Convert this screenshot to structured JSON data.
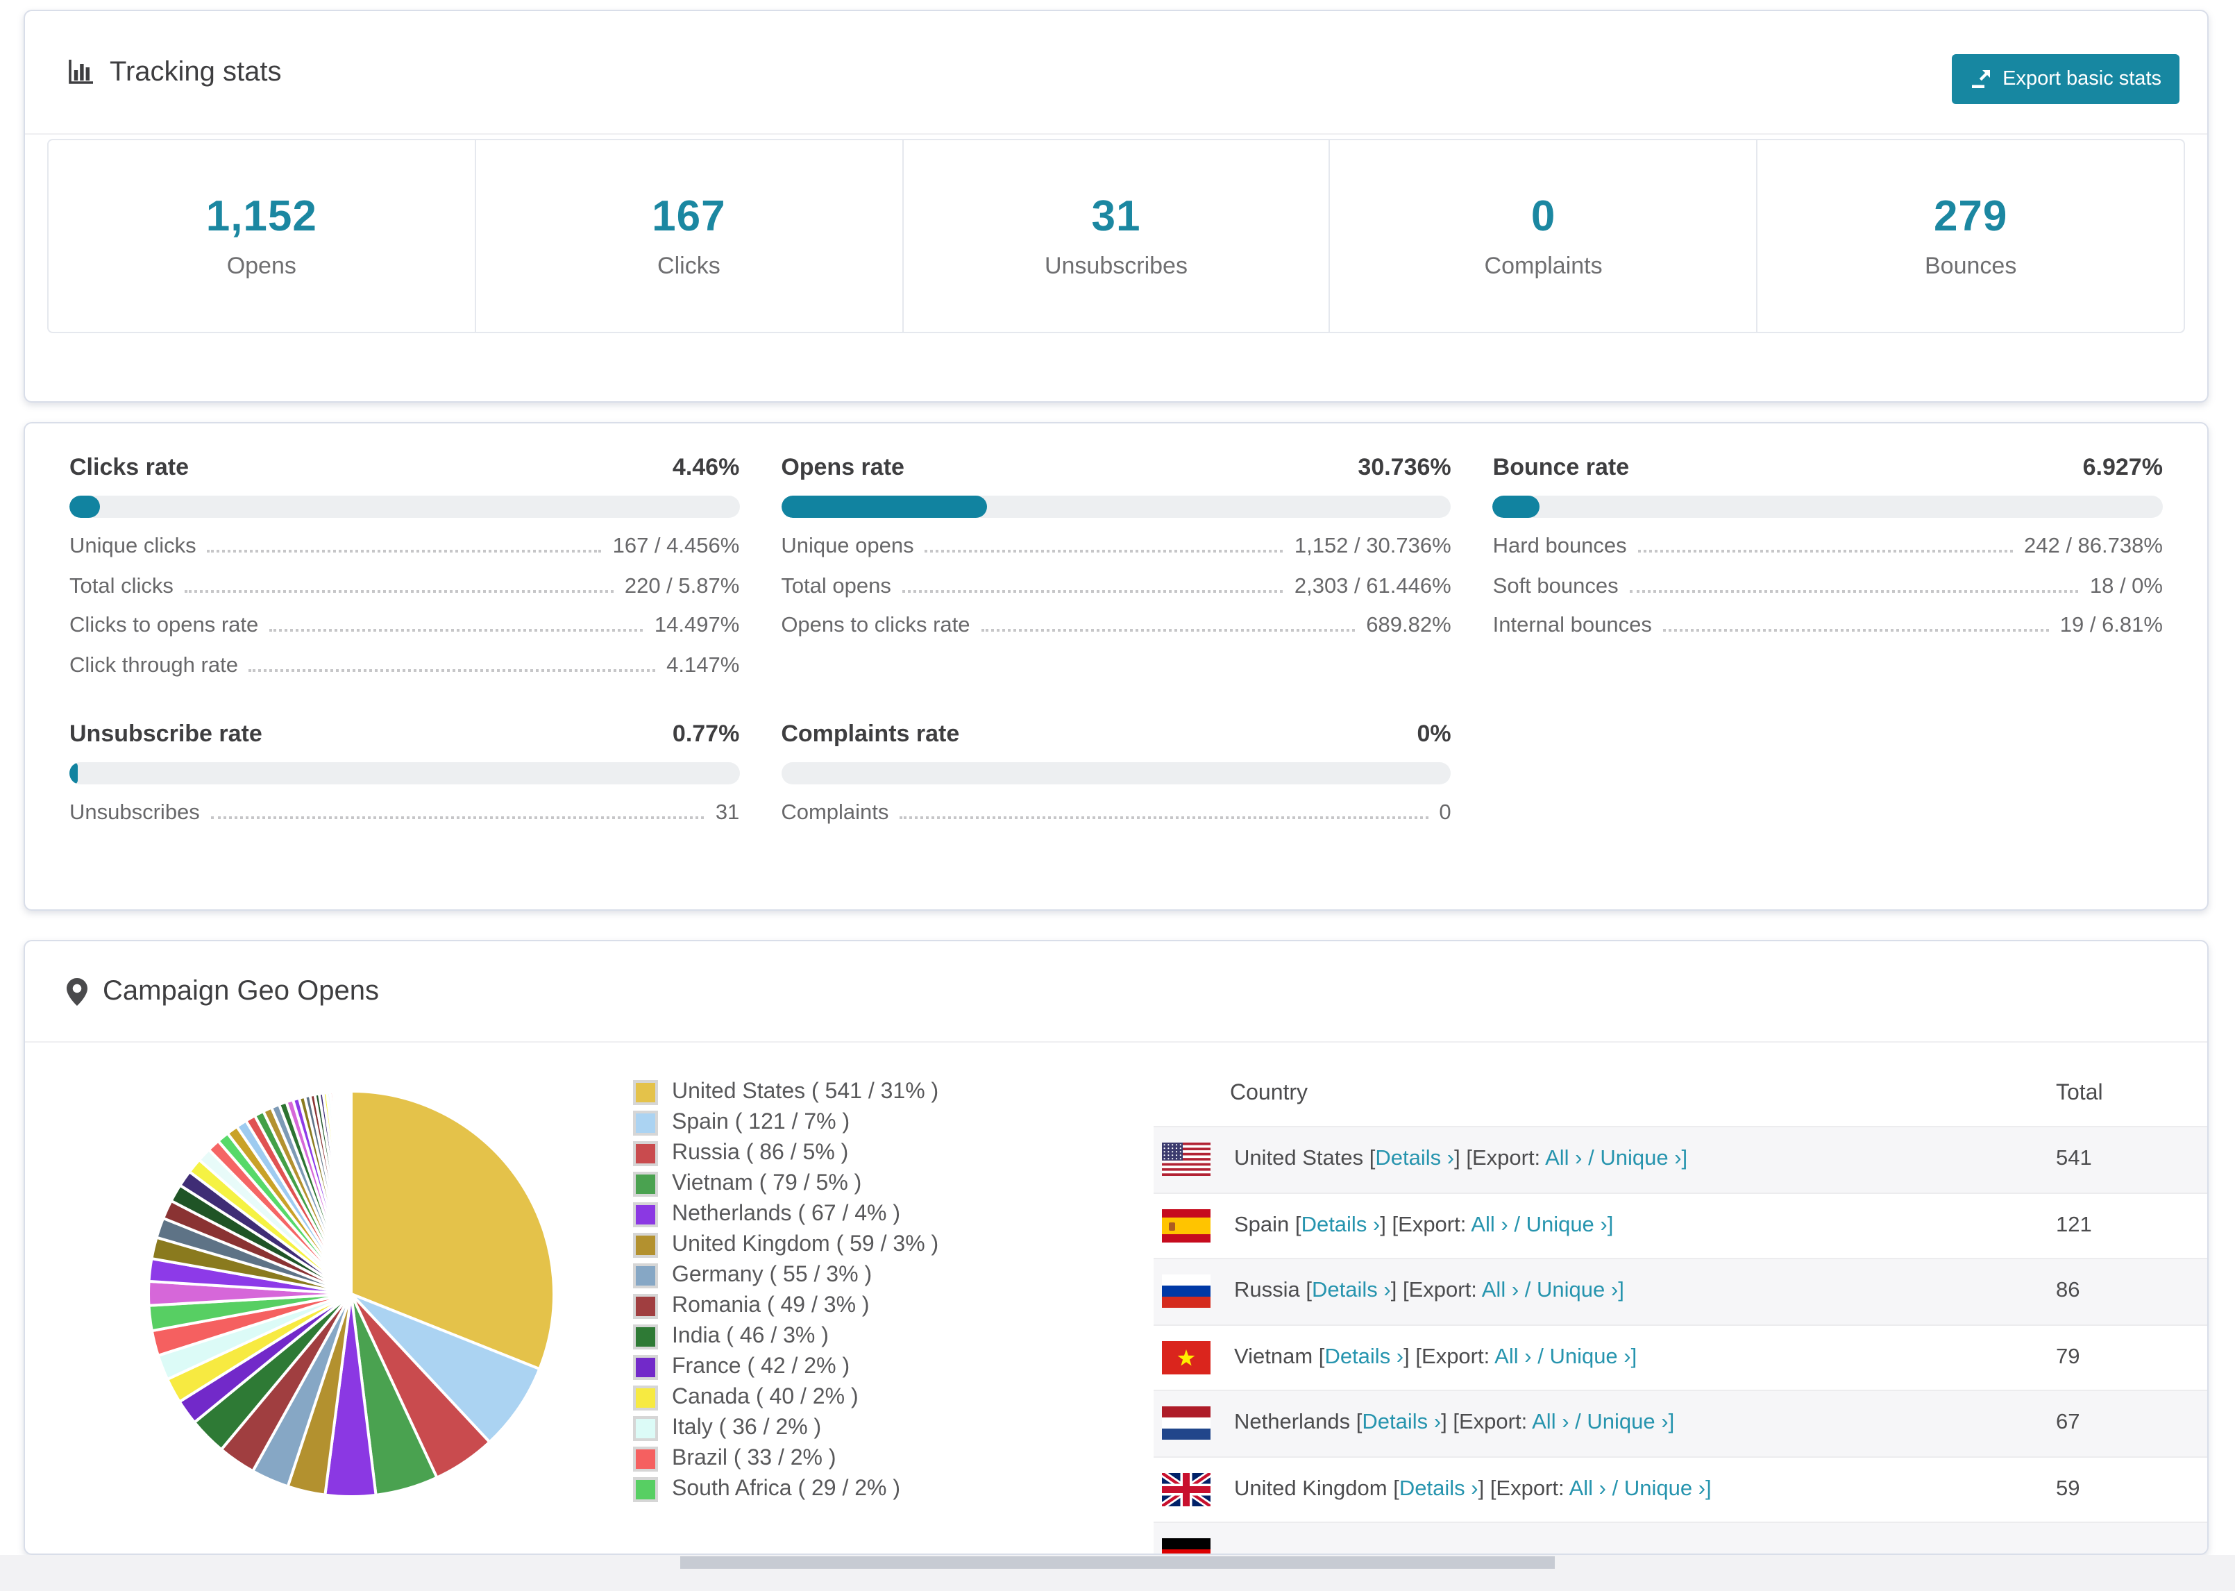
{
  "header": {
    "title": "Tracking stats",
    "export_button": "Export basic stats"
  },
  "accent_color": "#1787a1",
  "summary": [
    {
      "value": "1,152",
      "label": "Opens"
    },
    {
      "value": "167",
      "label": "Clicks"
    },
    {
      "value": "31",
      "label": "Unsubscribes"
    },
    {
      "value": "0",
      "label": "Complaints"
    },
    {
      "value": "279",
      "label": "Bounces"
    }
  ],
  "metrics": [
    {
      "id": "clicks",
      "title": "Clicks rate",
      "value": "4.46%",
      "percent": 4.46,
      "rows": [
        {
          "label": "Unique clicks",
          "value": "167 / 4.456%"
        },
        {
          "label": "Total clicks",
          "value": "220 / 5.87%"
        },
        {
          "label": "Clicks to opens rate",
          "value": "14.497%"
        },
        {
          "label": "Click through rate",
          "value": "4.147%"
        }
      ]
    },
    {
      "id": "opens",
      "title": "Opens rate",
      "value": "30.736%",
      "percent": 30.736,
      "rows": [
        {
          "label": "Unique opens",
          "value": "1,152 / 30.736%"
        },
        {
          "label": "Total opens",
          "value": "2,303 / 61.446%"
        },
        {
          "label": "Opens to clicks rate",
          "value": "689.82%"
        }
      ]
    },
    {
      "id": "bounce",
      "title": "Bounce rate",
      "value": "6.927%",
      "percent": 6.927,
      "rows": [
        {
          "label": "Hard bounces",
          "value": "242 / 86.738%"
        },
        {
          "label": "Soft bounces",
          "value": "18 / 0%"
        },
        {
          "label": "Internal bounces",
          "value": "19 / 6.81%"
        }
      ]
    },
    {
      "id": "unsubscribe",
      "title": "Unsubscribe rate",
      "value": "0.77%",
      "percent": 0.77,
      "rows": [
        {
          "label": "Unsubscribes",
          "value": "31"
        }
      ]
    },
    {
      "id": "complaints",
      "title": "Complaints rate",
      "value": "0%",
      "percent": 0,
      "rows": [
        {
          "label": "Complaints",
          "value": "0"
        }
      ]
    }
  ],
  "geo": {
    "title": "Campaign Geo Opens",
    "table": {
      "headers": [
        "Country",
        "Total"
      ],
      "link_labels": {
        "details": "Details ›",
        "export_prefix": "[Export:",
        "all": "All ›",
        "slash": "/",
        "unique": "Unique ›]"
      },
      "rows": [
        {
          "country": "United States",
          "flag": "us",
          "total": "541"
        },
        {
          "country": "Spain",
          "flag": "es",
          "total": "121"
        },
        {
          "country": "Russia",
          "flag": "ru",
          "total": "86"
        },
        {
          "country": "Vietnam",
          "flag": "vn",
          "total": "79"
        },
        {
          "country": "Netherlands",
          "flag": "nl",
          "total": "67"
        },
        {
          "country": "United Kingdom",
          "flag": "gb",
          "total": "59"
        },
        {
          "country": "",
          "flag": "de",
          "total": "",
          "partial": true
        }
      ]
    }
  },
  "chart_data": {
    "type": "pie",
    "title": "Campaign Geo Opens",
    "legend_position": "right",
    "labels": [
      "United States",
      "Spain",
      "Russia",
      "Vietnam",
      "Netherlands",
      "United Kingdom",
      "Germany",
      "Romania",
      "India",
      "France",
      "Canada",
      "Italy",
      "Brazil",
      "South Africa"
    ],
    "values": [
      541,
      121,
      86,
      79,
      67,
      59,
      55,
      49,
      46,
      42,
      40,
      36,
      33,
      29
    ],
    "percents": [
      31,
      7,
      5,
      5,
      4,
      3,
      3,
      3,
      3,
      2,
      2,
      2,
      2,
      2
    ],
    "colors": [
      "#e4c24a",
      "#abd3f2",
      "#c94b4e",
      "#4aa250",
      "#8b38e3",
      "#b3912f",
      "#86a7c5",
      "#a03e40",
      "#2e7a35",
      "#7229c9",
      "#f7ea41",
      "#dcfbf7",
      "#f56060",
      "#57cf63"
    ],
    "other_slices_percent_estimated": [
      1.9,
      1.8,
      1.7,
      1.6,
      1.5,
      1.4,
      1.3,
      1.2,
      1.1,
      1.0,
      0.95,
      0.9,
      0.85,
      0.8,
      0.75,
      0.7,
      0.65,
      0.6,
      0.55,
      0.5,
      0.46,
      0.42,
      0.38,
      0.35,
      0.32,
      0.29,
      0.26,
      0.23,
      0.2,
      0.18,
      0.16,
      0.14,
      0.12,
      0.1,
      0.09,
      0.08,
      0.07,
      0.06,
      0.05,
      0.045,
      0.04,
      0.035,
      0.03,
      0.025
    ],
    "other_palette": [
      "#d667d9",
      "#8d3ae8",
      "#8a7a1e",
      "#5e7386",
      "#8a3333",
      "#1f5426",
      "#3f2d75",
      "#f5f243",
      "#e8fbf9",
      "#f56565",
      "#57d969",
      "#c9a227",
      "#9ecbf0",
      "#e05252",
      "#43a047",
      "#b3912f",
      "#7d9ab5",
      "#2d7231"
    ]
  }
}
